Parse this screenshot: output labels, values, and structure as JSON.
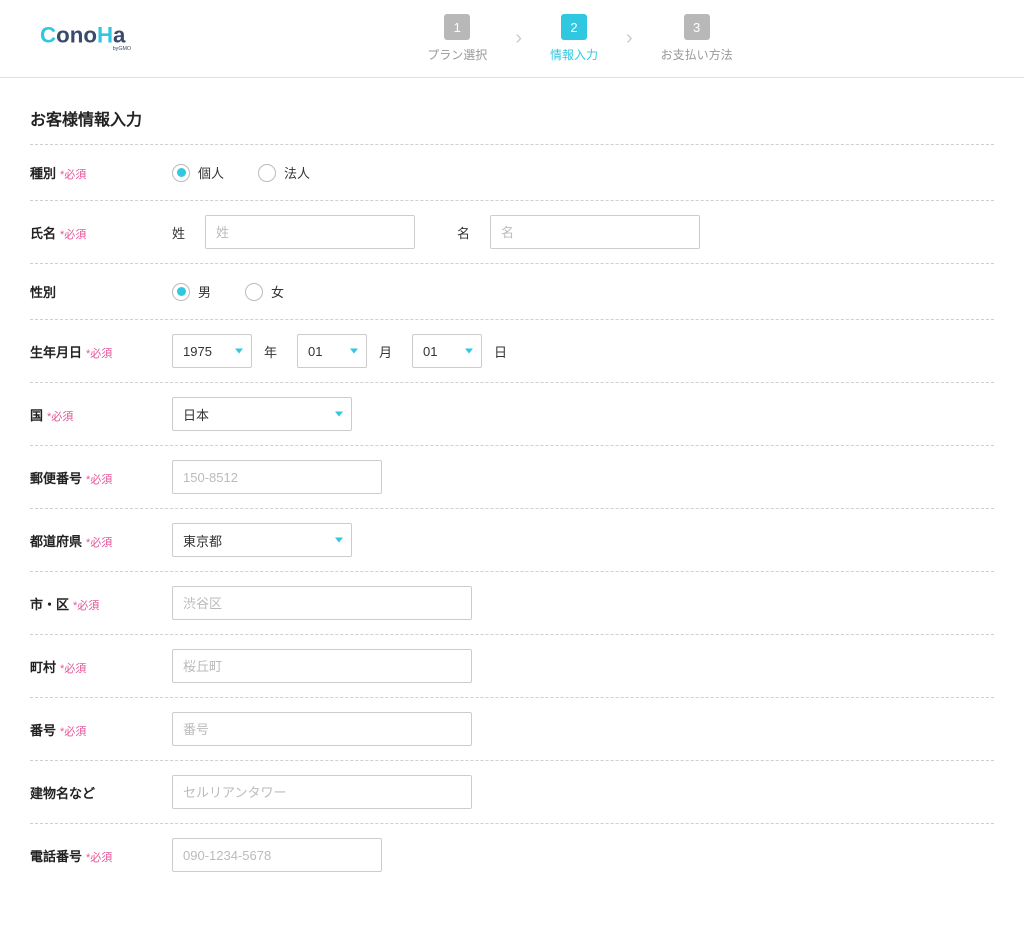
{
  "brand": {
    "name": "ConoHa",
    "tagline": "by GMO"
  },
  "steps": {
    "s1": {
      "num": "1",
      "label": "プラン選択"
    },
    "s2": {
      "num": "2",
      "label": "情報入力"
    },
    "s3": {
      "num": "3",
      "label": "お支払い方法"
    }
  },
  "heading": "お客様情報入力",
  "required": "*必須",
  "labels": {
    "type": "種別",
    "name": "氏名",
    "gender": "性別",
    "birth": "生年月日",
    "country": "国",
    "postal": "郵便番号",
    "prefecture": "都道府県",
    "city": "市・区",
    "town": "町村",
    "street": "番号",
    "building": "建物名など",
    "phone": "電話番号"
  },
  "radios": {
    "individual": "個人",
    "corporate": "法人",
    "male": "男",
    "female": "女"
  },
  "sublabels": {
    "lastname": "姓",
    "firstname": "名",
    "year": "年",
    "month": "月",
    "day": "日"
  },
  "placeholders": {
    "lastname": "姓",
    "firstname": "名",
    "postal": "150-8512",
    "city": "渋谷区",
    "town": "桜丘町",
    "street": "番号",
    "building": "セルリアンタワー",
    "phone": "090-1234-5678"
  },
  "values": {
    "year": "1975",
    "month": "01",
    "day": "01",
    "country": "日本",
    "prefecture": "東京都"
  }
}
